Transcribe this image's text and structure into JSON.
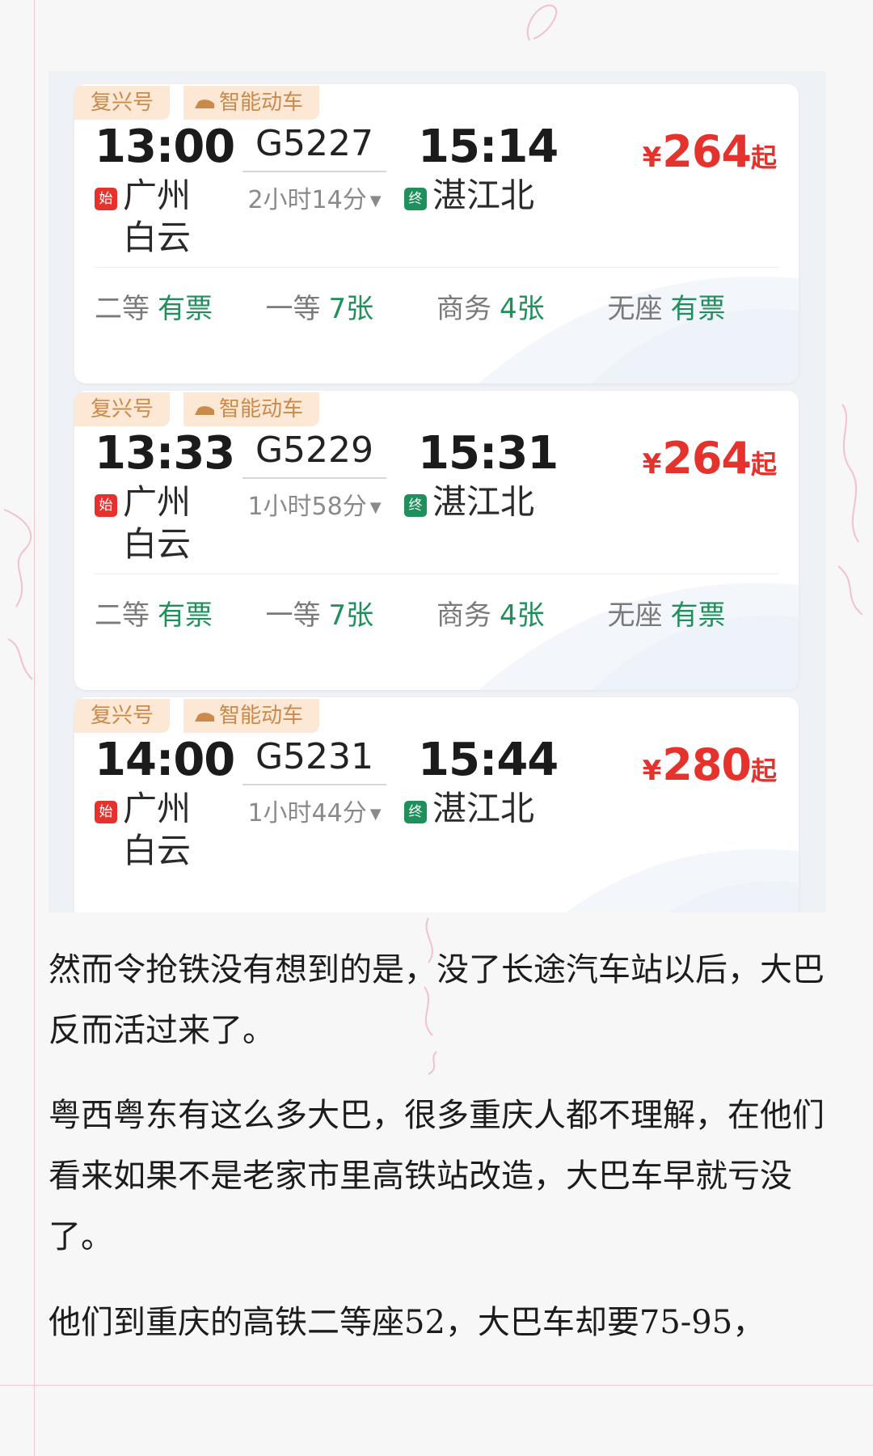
{
  "trains": [
    {
      "badges": {
        "type": "复兴号",
        "smart": "智能动车"
      },
      "dep_time": "13:00",
      "train_no": "G5227",
      "arr_time": "15:14",
      "duration": "2小时14分",
      "dep_tag": "始",
      "dep_station": "广州白云",
      "arr_tag": "终",
      "arr_station": "湛江北",
      "price_symbol": "¥",
      "price": "264",
      "price_suffix": "起",
      "seats": [
        {
          "name": "二等",
          "avail": "有票"
        },
        {
          "name": "一等",
          "avail": "7张"
        },
        {
          "name": "商务",
          "avail": "4张"
        },
        {
          "name": "无座",
          "avail": "有票"
        }
      ]
    },
    {
      "badges": {
        "type": "复兴号",
        "smart": "智能动车"
      },
      "dep_time": "13:33",
      "train_no": "G5229",
      "arr_time": "15:31",
      "duration": "1小时58分",
      "dep_tag": "始",
      "dep_station": "广州白云",
      "arr_tag": "终",
      "arr_station": "湛江北",
      "price_symbol": "¥",
      "price": "264",
      "price_suffix": "起",
      "seats": [
        {
          "name": "二等",
          "avail": "有票"
        },
        {
          "name": "一等",
          "avail": "7张"
        },
        {
          "name": "商务",
          "avail": "4张"
        },
        {
          "name": "无座",
          "avail": "有票"
        }
      ]
    },
    {
      "badges": {
        "type": "复兴号",
        "smart": "智能动车"
      },
      "dep_time": "14:00",
      "train_no": "G5231",
      "arr_time": "15:44",
      "duration": "1小时44分",
      "dep_tag": "始",
      "dep_station": "广州白云",
      "arr_tag": "终",
      "arr_station": "湛江北",
      "price_symbol": "¥",
      "price": "280",
      "price_suffix": "起"
    }
  ],
  "article": {
    "p1": "然而令抢铁没有想到的是，没了长途汽车站以后，大巴反而活过来了。",
    "p2": "粤西粤东有这么多大巴，很多重庆人都不理解，在他们看来如果不是老家市里高铁站改造，大巴车早就亏没了。",
    "p3": "他们到重庆的高铁二等座52，大巴车却要75-95，"
  },
  "colors": {
    "accent_red": "#e5322d",
    "available_green": "#1f8f5b",
    "badge_bg": "#fce8d4",
    "badge_text": "#c98a4c"
  }
}
